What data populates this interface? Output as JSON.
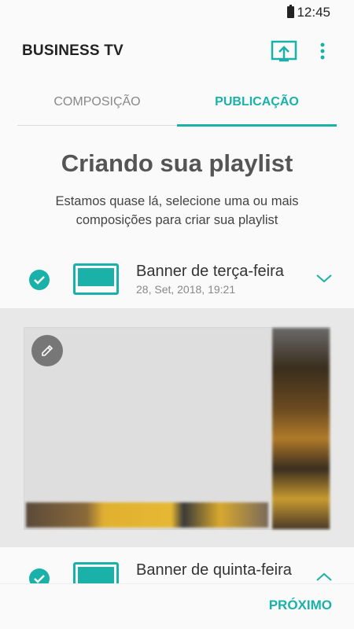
{
  "status_bar": {
    "time": "12:45",
    "battery_icon": "battery-icon"
  },
  "app_bar": {
    "title": "BUSINESS TV",
    "cast_icon": "cast-icon",
    "more_icon": "more-vert-icon"
  },
  "tabs": [
    {
      "label": "COMPOSIÇÃO",
      "active": false
    },
    {
      "label": "PUBLICAÇÃO",
      "active": true
    }
  ],
  "heading": "Criando sua playlist",
  "subtitle": "Estamos quase lá, selecione uma ou mais composições para criar sua playlist",
  "items": [
    {
      "name": "Banner de terça-feira",
      "date": "28, Set, 2018, 19:21",
      "checked": true,
      "expanded": true
    },
    {
      "name": "Banner de quinta-feira",
      "date": "",
      "checked": true,
      "expanded": false
    }
  ],
  "next_label": "PRÓXIMO",
  "colors": {
    "accent": "#1ab1a8",
    "background": "#fafafa",
    "preview_bg": "#e8e8e8"
  }
}
